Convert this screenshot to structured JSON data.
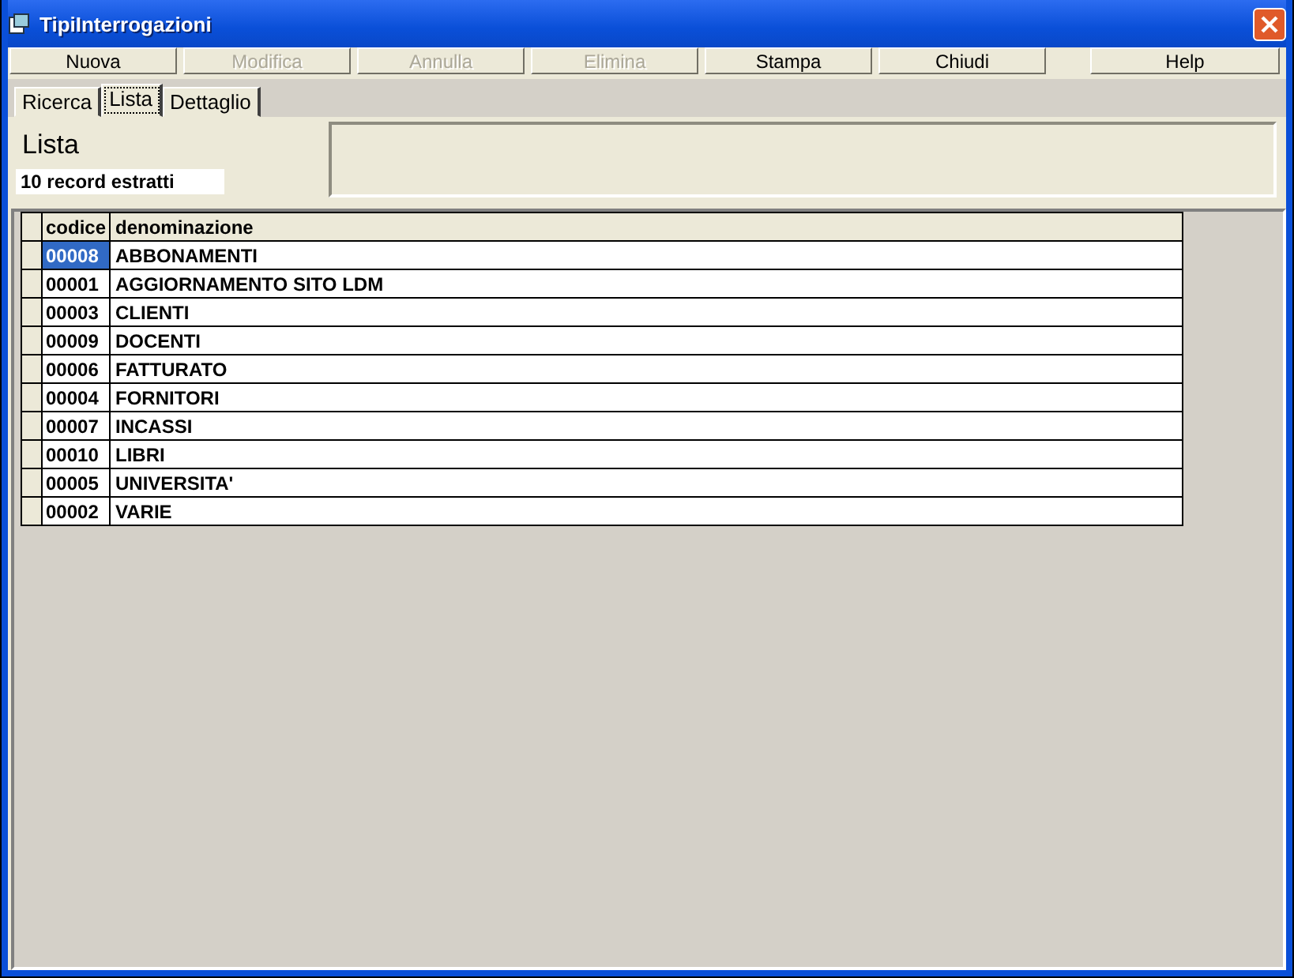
{
  "window": {
    "title": "TipiInterrogazioni"
  },
  "toolbar": [
    {
      "label": "Nuova",
      "disabled": false
    },
    {
      "label": "Modifica",
      "disabled": true
    },
    {
      "label": "Annulla",
      "disabled": true
    },
    {
      "label": "Elimina",
      "disabled": true
    },
    {
      "label": "Stampa",
      "disabled": false
    },
    {
      "label": "Chiudi",
      "disabled": false
    },
    {
      "label": "Help",
      "disabled": false
    }
  ],
  "tabs": [
    {
      "label": "Ricerca",
      "selected": false
    },
    {
      "label": "Lista",
      "selected": true
    },
    {
      "label": "Dettaglio",
      "selected": false
    }
  ],
  "panel": {
    "title": "Lista",
    "count": "10 record estratti"
  },
  "table": {
    "columns": [
      "codice",
      "denominazione"
    ],
    "rows": [
      {
        "cells": [
          "00008",
          "ABBONAMENTI"
        ],
        "selected": true
      },
      {
        "cells": [
          "00001",
          "AGGIORNAMENTO SITO LDM"
        ],
        "selected": false
      },
      {
        "cells": [
          "00003",
          "CLIENTI"
        ],
        "selected": false
      },
      {
        "cells": [
          "00009",
          "DOCENTI"
        ],
        "selected": false
      },
      {
        "cells": [
          "00006",
          "FATTURATO"
        ],
        "selected": false
      },
      {
        "cells": [
          "00004",
          "FORNITORI"
        ],
        "selected": false
      },
      {
        "cells": [
          "00007",
          "INCASSI"
        ],
        "selected": false
      },
      {
        "cells": [
          "00010",
          "LIBRI"
        ],
        "selected": false
      },
      {
        "cells": [
          "00005",
          "UNIVERSITA'"
        ],
        "selected": false
      },
      {
        "cells": [
          "00002",
          "VARIE"
        ],
        "selected": false
      }
    ]
  }
}
